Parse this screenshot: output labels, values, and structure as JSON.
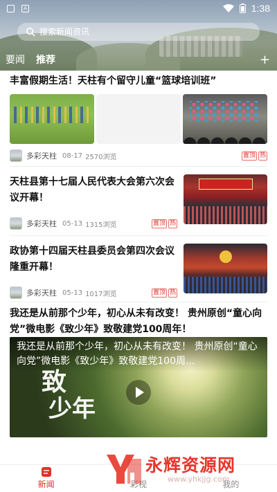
{
  "statusbar": {
    "time": "1:38",
    "icons": [
      "notification-icon",
      "a-icon",
      "wifi-icon",
      "battery-icon"
    ]
  },
  "search": {
    "placeholder": "搜索新闻资讯"
  },
  "tabs": [
    {
      "label": "要闻"
    },
    {
      "label": "推荐"
    }
  ],
  "feed": {
    "items": [
      {
        "title": "丰富假期生活！天柱有个留守儿童“篮球培训班”",
        "source": "多彩天柱",
        "date": "08-17",
        "views": "2570浏览",
        "badges": [
          "置顶",
          "热"
        ]
      },
      {
        "title": "天柱县第十七届人民代表大会第六次会议开幕！",
        "source": "多彩天柱",
        "date": "05-13",
        "views": "1315浏览",
        "badges": [
          "置顶",
          "热"
        ]
      },
      {
        "title": "政协第十四届天柱县委员会第四次会议隆重开幕！",
        "source": "多彩天柱",
        "date": "05-13",
        "views": "1017浏览",
        "badges": [
          "置顶",
          "热"
        ]
      },
      {
        "title": "我还是从前那个少年，初心从未有改变！ 贵州原创“童心向党”微电影《致少年》致敬建党100周年！",
        "video_title": "我还是从前那个少年，初心从未有改变！ 贵州原创“童心向党”微电影《致少年》致敬建党100周...",
        "video_art": [
          "致",
          "少年"
        ]
      }
    ]
  },
  "bottom_nav": [
    {
      "label": "新闻",
      "icon": "news-icon",
      "active": true
    },
    {
      "label": "彩视",
      "icon": "video-icon",
      "active": false
    },
    {
      "label": "我的",
      "icon": "profile-icon",
      "active": false
    }
  ],
  "watermark": {
    "text": "永辉资源网",
    "url": "www.yhkjjg.com"
  },
  "colors": {
    "accent": "#e0322a",
    "badge": "#d9342b"
  }
}
